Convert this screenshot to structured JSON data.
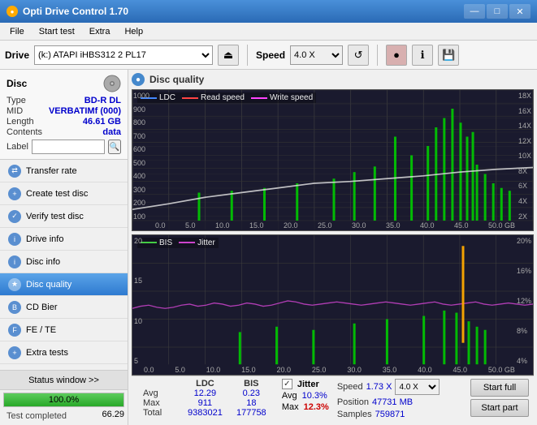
{
  "titlebar": {
    "title": "Opti Drive Control 1.70",
    "minimize": "—",
    "maximize": "□",
    "close": "✕"
  },
  "menubar": {
    "items": [
      "File",
      "Start test",
      "Extra",
      "Help"
    ]
  },
  "toolbar": {
    "drive_label": "Drive",
    "drive_value": "(k:) ATAPI iHBS312  2 PL17",
    "speed_label": "Speed",
    "speed_value": "4.0 X"
  },
  "disc": {
    "type_label": "Type",
    "type_value": "BD-R DL",
    "mid_label": "MID",
    "mid_value": "VERBATIMf (000)",
    "length_label": "Length",
    "length_value": "46.61 GB",
    "contents_label": "Contents",
    "contents_value": "data",
    "label_label": "Label"
  },
  "nav": {
    "items": [
      {
        "id": "transfer-rate",
        "label": "Transfer rate"
      },
      {
        "id": "create-test-disc",
        "label": "Create test disc"
      },
      {
        "id": "verify-test-disc",
        "label": "Verify test disc"
      },
      {
        "id": "drive-info",
        "label": "Drive info"
      },
      {
        "id": "disc-info",
        "label": "Disc info"
      },
      {
        "id": "disc-quality",
        "label": "Disc quality",
        "active": true
      },
      {
        "id": "cd-bier",
        "label": "CD Bier"
      },
      {
        "id": "fe-te",
        "label": "FE / TE"
      },
      {
        "id": "extra-tests",
        "label": "Extra tests"
      }
    ]
  },
  "status": {
    "window_btn": "Status window >>",
    "progress": "100.0%",
    "progress_val": 100,
    "status_text": "Test completed",
    "version": "66.29"
  },
  "disc_quality": {
    "title": "Disc quality",
    "legend_top": [
      "LDC",
      "Read speed",
      "Write speed"
    ],
    "legend_bottom": [
      "BIS",
      "Jitter"
    ],
    "y_top": [
      "1000",
      "900",
      "800",
      "700",
      "600",
      "500",
      "400",
      "300",
      "200",
      "100"
    ],
    "y_top_right": [
      "18X",
      "16X",
      "14X",
      "12X",
      "10X",
      "8X",
      "6X",
      "4X",
      "2X"
    ],
    "y_bottom": [
      "20",
      "15",
      "10",
      "5"
    ],
    "y_bottom_right": [
      "20%",
      "16%",
      "12%",
      "8%",
      "4%"
    ],
    "x_labels": [
      "0.0",
      "5.0",
      "10.0",
      "15.0",
      "20.0",
      "25.0",
      "30.0",
      "35.0",
      "40.0",
      "45.0",
      "50.0 GB"
    ]
  },
  "stats": {
    "col_ldc": "LDC",
    "col_bis": "BIS",
    "col_jitter": "Jitter",
    "rows": [
      {
        "label": "Avg",
        "ldc": "12.29",
        "bis": "0.23",
        "jitter": "10.3%"
      },
      {
        "label": "Max",
        "ldc": "911",
        "bis": "18",
        "jitter": "12.3%"
      },
      {
        "label": "Total",
        "ldc": "9383021",
        "bis": "177758",
        "jitter": ""
      }
    ],
    "jitter_checked": true,
    "speed_label": "Speed",
    "speed_val": "1.73 X",
    "speed_select": "4.0 X",
    "position_label": "Position",
    "position_val": "47731 MB",
    "samples_label": "Samples",
    "samples_val": "759871",
    "btn_start_full": "Start full",
    "btn_start_part": "Start part"
  }
}
